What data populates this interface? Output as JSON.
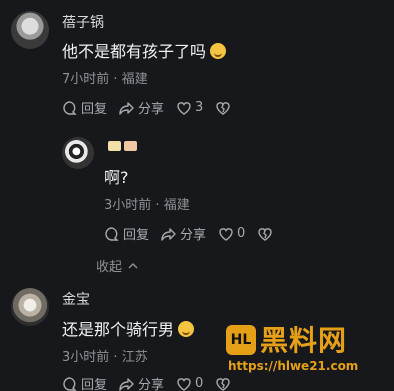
{
  "comments": [
    {
      "user": "蓓子锅",
      "content": "他不是都有孩子了吗",
      "emoji": "smile-emoji",
      "time": "7小时前",
      "location": "福建",
      "reply_label": "回复",
      "share_label": "分享",
      "likes": "3"
    },
    {
      "user": "",
      "badges": [
        "#f2e0a8",
        "#f0c7a0"
      ],
      "content": "啊?",
      "time": "3小时前",
      "location": "福建",
      "reply_label": "回复",
      "share_label": "分享",
      "likes": "0"
    },
    {
      "user": "金宝",
      "content": "还是那个骑行男",
      "emoji": "grimace-emoji",
      "time": "3小时前",
      "location": "江苏",
      "reply_label": "回复",
      "share_label": "分享",
      "likes": "0"
    }
  ],
  "collapse_label": "收起",
  "separator": "·",
  "watermark": {
    "text": "黑料网",
    "url": "https://hlwe21.com",
    "logo": "HL"
  },
  "colors": {
    "background": "#16181c",
    "watermark": "#e5a018"
  }
}
